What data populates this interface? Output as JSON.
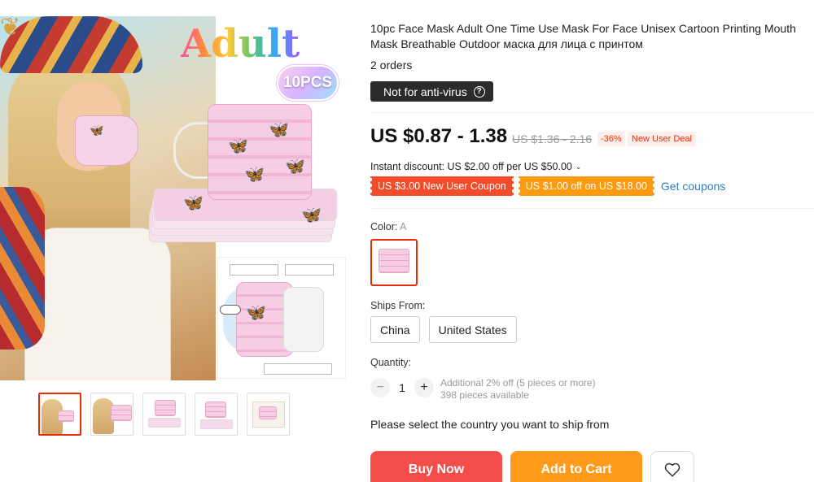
{
  "gallery": {
    "badge_title": "Adult",
    "badge_pcs": "10PCS",
    "thumbnails": [
      {
        "name": "thumb-woman-mask"
      },
      {
        "name": "thumb-woman-mask-2"
      },
      {
        "name": "thumb-mask-stack"
      },
      {
        "name": "thumb-mask-flat"
      },
      {
        "name": "thumb-package"
      }
    ]
  },
  "product": {
    "title": "10pc Face Mask Adult One Time Use Mask For Face Unisex Cartoon Printing Mouth Mask Breathable Outdoor маска для лица с принтом",
    "orders": "2 orders",
    "notice": "Not for anti-virus",
    "notice_icon": "question-circle-icon"
  },
  "pricing": {
    "price": "US $0.87 - 1.38",
    "original_price": "US $1.36 - 2.16",
    "discount": "-36%",
    "deal": "New User Deal",
    "instant_discount": "Instant discount: US $2.00 off per US $50.00",
    "coupons": [
      {
        "label": "US $3.00 New User Coupon",
        "color": "#f24c2b"
      },
      {
        "label": "US $1.00 off on US $18.00",
        "color": "#fe9a0f"
      }
    ],
    "get_coupons": "Get coupons"
  },
  "options": {
    "color_label": "Color:",
    "color_value": "A",
    "ships_from_label": "Ships From:",
    "ships_from": [
      "China",
      "United States"
    ]
  },
  "quantity": {
    "label": "Quantity:",
    "value": "1",
    "minus": "−",
    "plus": "+",
    "bulk_note": "Additional 2% off (5 pieces or more)",
    "available": "398 pieces available"
  },
  "actions": {
    "country_message": "Please select the country you want to ship from",
    "buy_now": "Buy Now",
    "add_to_cart": "Add to Cart",
    "wishlist_icon": "heart-icon"
  },
  "colors": {
    "accent": "#e62e04",
    "buy": "#f44d4a",
    "cart": "#ff9a1a",
    "link": "#2e7fbf"
  }
}
